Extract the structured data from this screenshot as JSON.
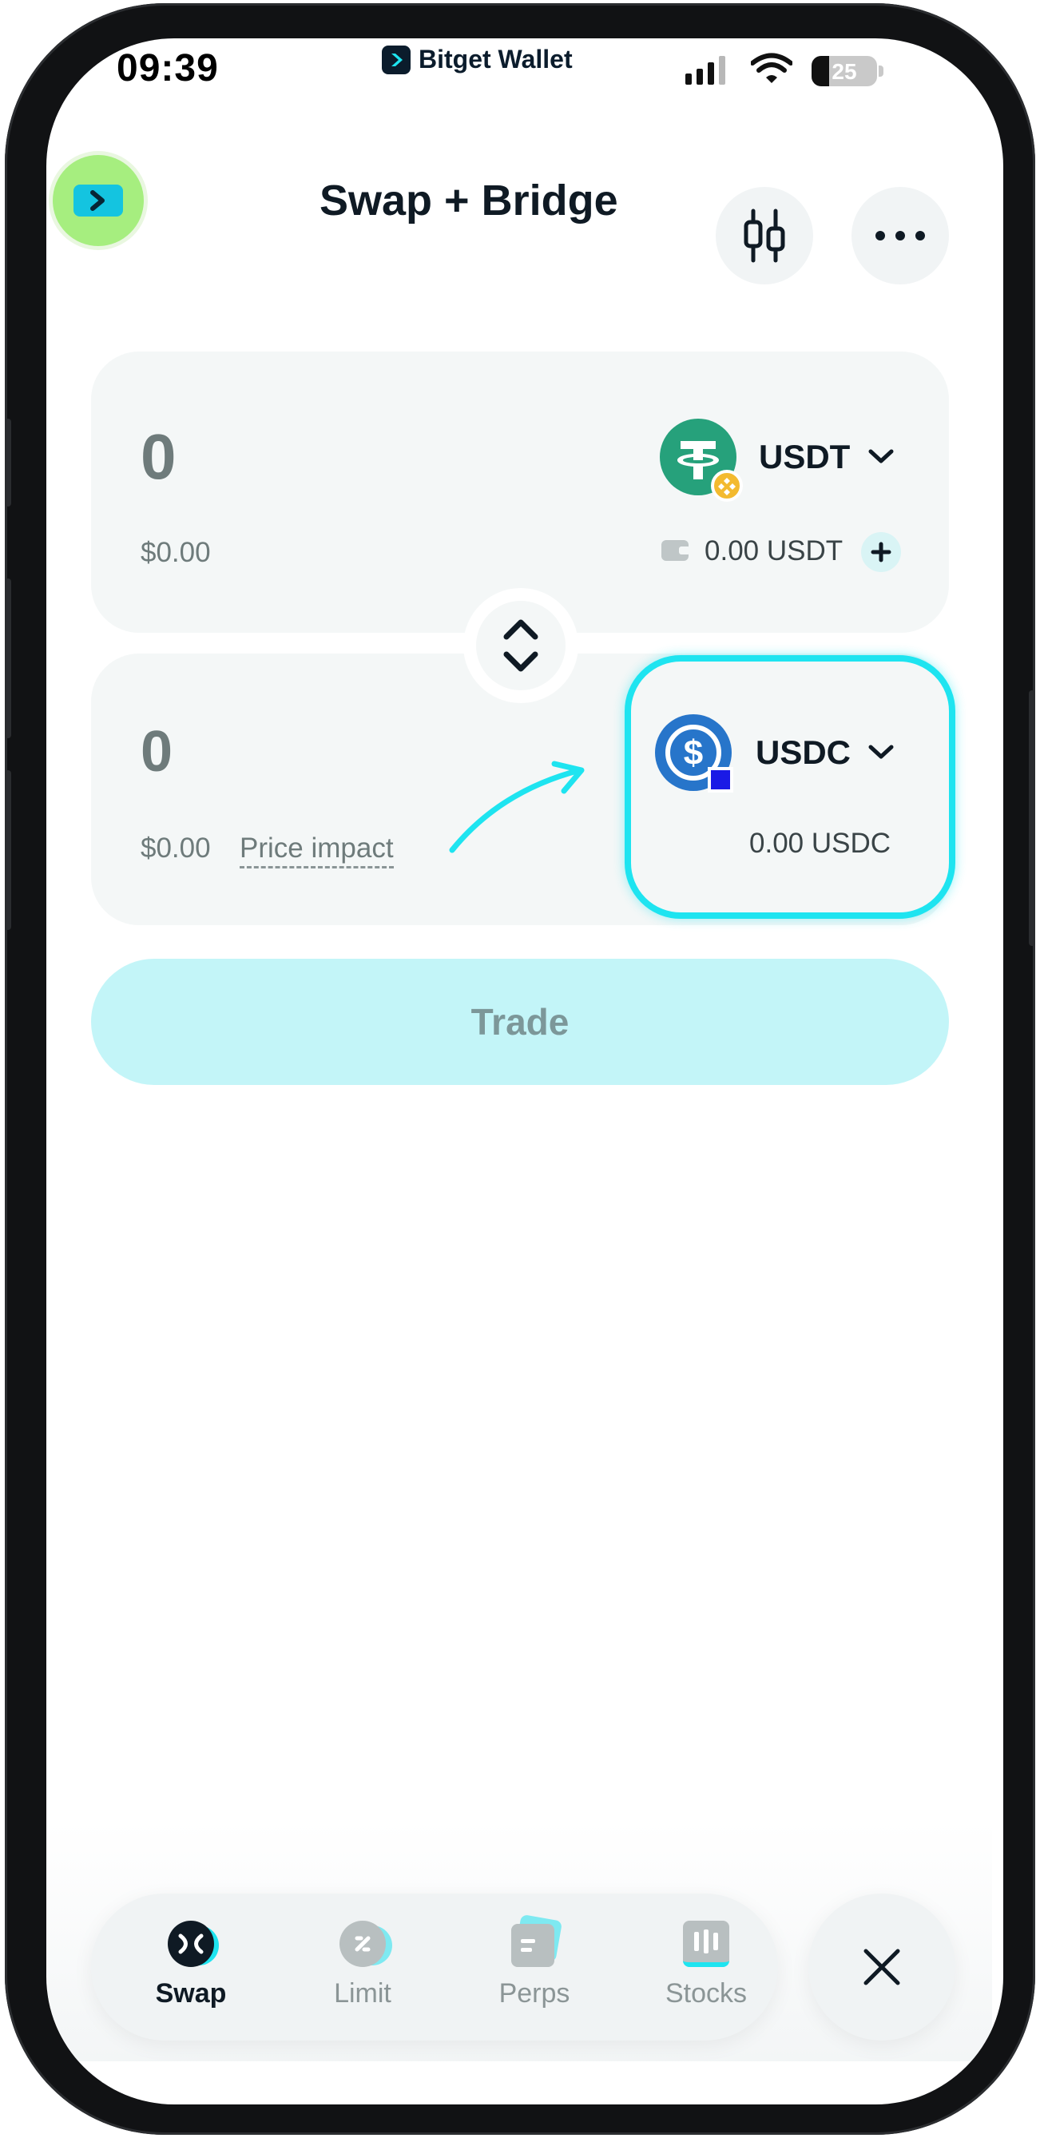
{
  "status_bar": {
    "time": "09:39",
    "brand": "Bitget Wallet",
    "battery": "25"
  },
  "header": {
    "title": "Swap + Bridge",
    "icons": [
      "avatar-wallet-icon",
      "candlestick-chart-icon",
      "more-icon"
    ]
  },
  "from": {
    "amount": "0",
    "fiat": "$0.00",
    "token": "USDT",
    "balance": "0.00 USDT",
    "chain_badge": "bnb-chain-icon"
  },
  "to": {
    "amount": "0",
    "fiat": "$0.00",
    "price_impact_label": "Price impact",
    "token": "USDC",
    "balance": "0.00 USDC"
  },
  "trade_button": "Trade",
  "bottom_nav": {
    "items": [
      {
        "label": "Swap",
        "active": true,
        "icon": "swap-icon"
      },
      {
        "label": "Limit",
        "active": false,
        "icon": "limit-icon"
      },
      {
        "label": "Perps",
        "active": false,
        "icon": "perps-icon"
      },
      {
        "label": "Stocks",
        "active": false,
        "icon": "stocks-icon"
      }
    ]
  },
  "colors": {
    "accent": "#1ee4f0",
    "trade_button_bg": "#c3f5f8",
    "usdt": "#26a17b",
    "usdc": "#2775ca",
    "avatar_bg": "#a6ee7f"
  }
}
